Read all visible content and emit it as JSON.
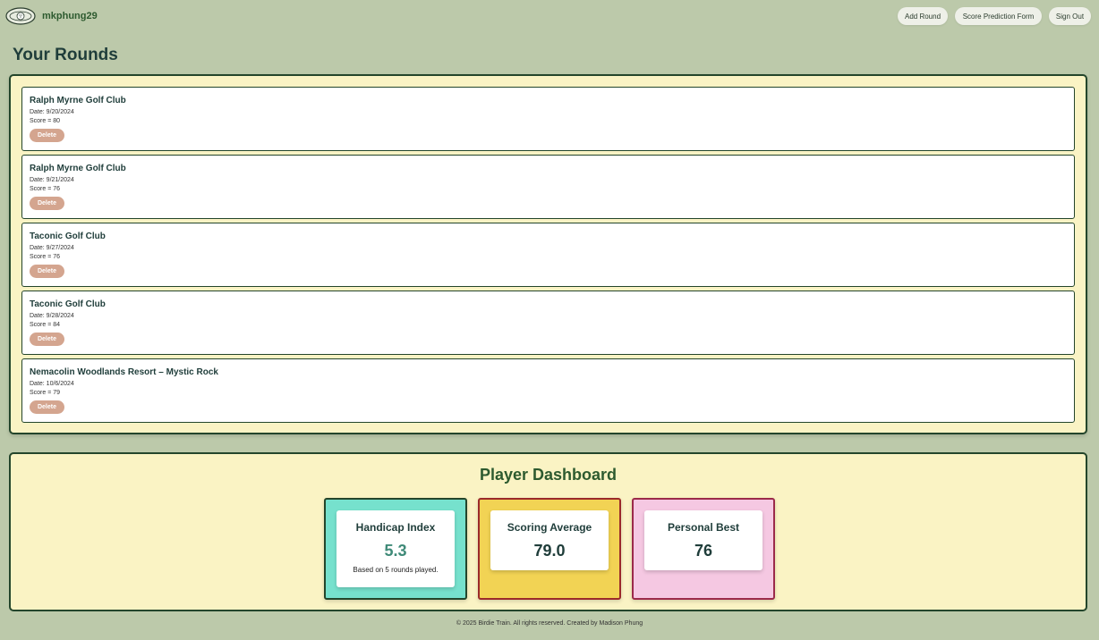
{
  "header": {
    "username": "mkphung29",
    "logo_icon": "golf-ball-logo-icon",
    "nav": {
      "add_round": "Add Round",
      "score_prediction": "Score Prediction Form",
      "sign_out": "Sign Out"
    }
  },
  "page_title": "Your Rounds",
  "rounds": [
    {
      "course": "Ralph Myrne Golf Club",
      "date": "Date: 9/20/2024",
      "score": "Score = 80",
      "delete_label": "Delete"
    },
    {
      "course": "Ralph Myrne Golf Club",
      "date": "Date: 9/21/2024",
      "score": "Score = 76",
      "delete_label": "Delete"
    },
    {
      "course": "Taconic Golf Club",
      "date": "Date: 9/27/2024",
      "score": "Score = 76",
      "delete_label": "Delete"
    },
    {
      "course": "Taconic Golf Club",
      "date": "Date: 9/28/2024",
      "score": "Score = 84",
      "delete_label": "Delete"
    },
    {
      "course": "Nemacolin Woodlands Resort – Mystic Rock",
      "date": "Date: 10/6/2024",
      "score": "Score = 79",
      "delete_label": "Delete"
    }
  ],
  "dashboard": {
    "title": "Player Dashboard",
    "handicap": {
      "label": "Handicap Index",
      "value": "5.3",
      "note": "Based on 5 rounds played."
    },
    "average": {
      "label": "Scoring Average",
      "value": "79.0"
    },
    "best": {
      "label": "Personal Best",
      "value": "76"
    }
  },
  "footer": "© 2025 Birdie Train. All rights reserved. Created by Madison Phung",
  "colors": {
    "background": "#bcc9aa",
    "panel": "#faf3c4",
    "panel_border": "#23452b",
    "delete_button": "#d4a58f",
    "handicap_tile": "#76e1cd",
    "average_tile": "#f2d354",
    "best_tile": "#f5c8e2"
  }
}
